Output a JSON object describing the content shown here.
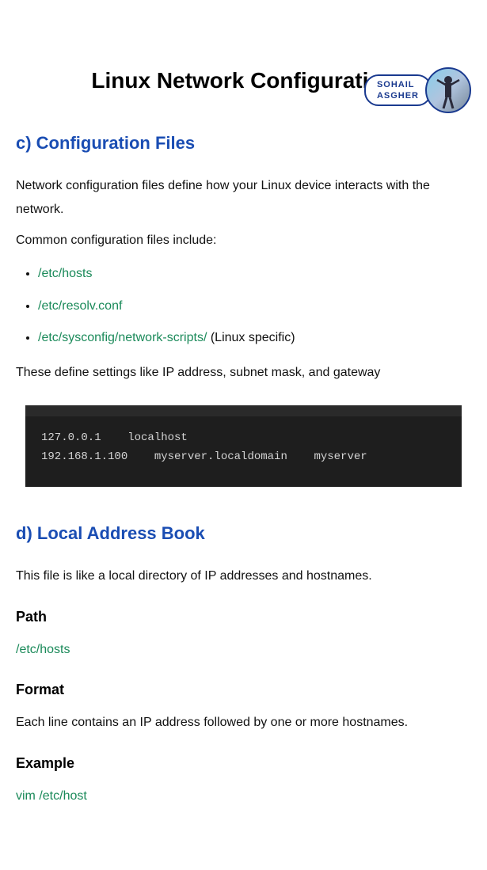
{
  "author": {
    "line1": "SOHAIL",
    "line2": "ASGHER"
  },
  "title": "Linux Network Configuration",
  "sectionC": {
    "heading": "c) Configuration Files",
    "para1": "Network configuration files define how your Linux device interacts with the network.",
    "para2": "Common configuration files include:",
    "items": [
      {
        "path": "/etc/hosts",
        "note": ""
      },
      {
        "path": "/etc/resolv.conf",
        "note": ""
      },
      {
        "path": "/etc/sysconfig/network-scripts/",
        "note": " (Linux specific)"
      }
    ],
    "para3": "These define settings like IP address, subnet mask, and gateway"
  },
  "terminal": {
    "line1": "127.0.0.1    localhost",
    "line2": "192.168.1.100    myserver.localdomain    myserver"
  },
  "sectionD": {
    "heading": "d) Local Address Book",
    "para1": "This file is like a local directory of IP addresses and hostnames.",
    "pathLabel": "Path",
    "pathValue": "/etc/hosts",
    "formatLabel": "Format",
    "formatText": "Each line contains an IP address followed by one or more hostnames.",
    "exampleLabel": "Example",
    "exampleText": "vim /etc/host"
  }
}
